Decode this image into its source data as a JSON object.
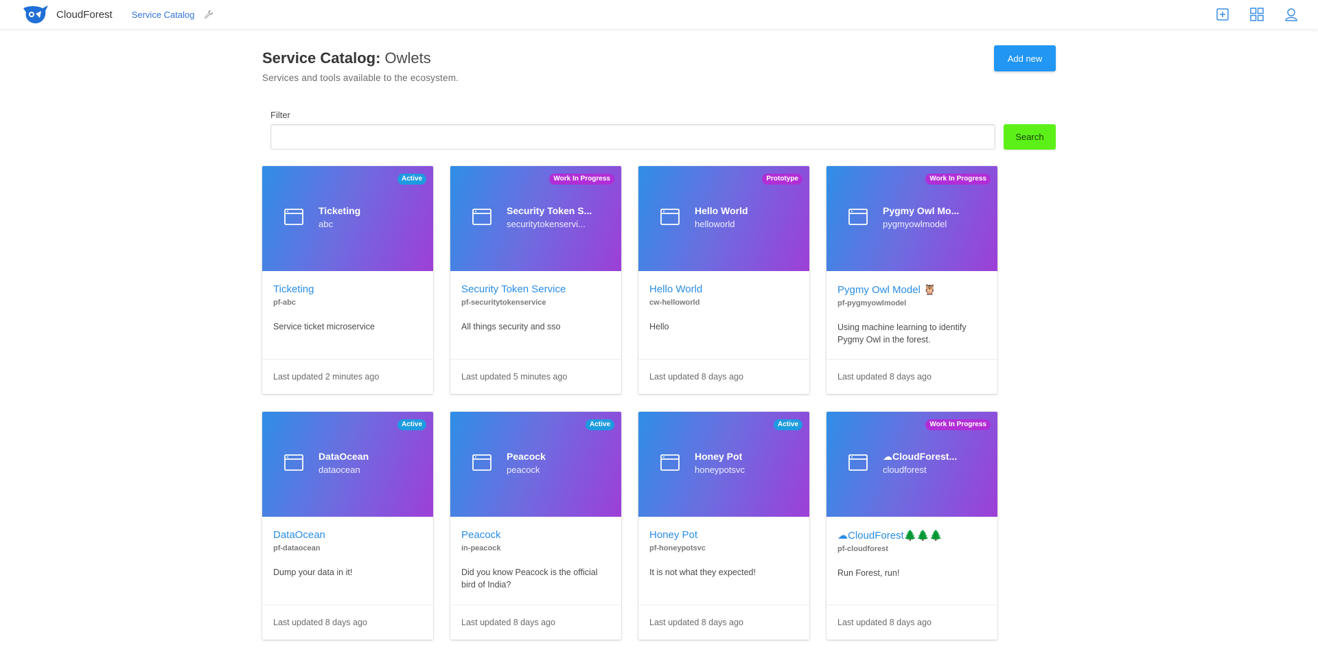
{
  "nav": {
    "brand": "CloudForest",
    "link": "Service Catalog"
  },
  "header": {
    "title_bold": "Service Catalog:",
    "title_sub": "Owlets",
    "description": "Services and tools available to the ecosystem.",
    "add_label": "Add new"
  },
  "filter": {
    "label": "Filter",
    "value": "",
    "search_label": "Search"
  },
  "cards": [
    {
      "badge": "Active",
      "badge_type": "active",
      "hero_title": "Ticketing",
      "hero_sub": "abc",
      "title": "Ticketing",
      "code": "pf-abc",
      "description": "Service ticket microservice",
      "updated": "Last updated 2 minutes ago"
    },
    {
      "badge": "Work In Progress",
      "badge_type": "wip",
      "hero_title": "Security Token S...",
      "hero_sub": "securitytokenservi...",
      "title": "Security Token Service",
      "code": "pf-securitytokenservice",
      "description": "All things security and sso",
      "updated": "Last updated 5 minutes ago"
    },
    {
      "badge": "Prototype",
      "badge_type": "proto",
      "hero_title": "Hello World",
      "hero_sub": "helloworld",
      "title": "Hello World",
      "code": "cw-helloworld",
      "description": "Hello",
      "updated": "Last updated 8 days ago"
    },
    {
      "badge": "Work In Progress",
      "badge_type": "wip",
      "hero_title": "Pygmy Owl Mo...",
      "hero_sub": "pygmyowlmodel",
      "title": "Pygmy Owl Model 🦉",
      "code": "pf-pygmyowlmodel",
      "description": "Using machine learning to identify Pygmy Owl in the forest.",
      "updated": "Last updated 8 days ago"
    },
    {
      "badge": "Active",
      "badge_type": "active",
      "hero_title": "DataOcean",
      "hero_sub": "dataocean",
      "title": "DataOcean",
      "code": "pf-dataocean",
      "description": "Dump your data in it!",
      "updated": "Last updated 8 days ago"
    },
    {
      "badge": "Active",
      "badge_type": "active",
      "hero_title": "Peacock",
      "hero_sub": "peacock",
      "title": "Peacock",
      "code": "in-peacock",
      "description": "Did you know Peacock is the official bird of India?",
      "updated": "Last updated 8 days ago"
    },
    {
      "badge": "Active",
      "badge_type": "active",
      "hero_title": "Honey Pot",
      "hero_sub": "honeypotsvc",
      "title": "Honey Pot",
      "code": "pf-honeypotsvc",
      "description": "It is not what they expected!",
      "updated": "Last updated 8 days ago"
    },
    {
      "badge": "Work In Progress",
      "badge_type": "wip",
      "hero_title": "☁CloudForest...",
      "hero_sub": "cloudforest",
      "title": "☁CloudForest🌲🌲🌲",
      "code": "pf-cloudforest",
      "description": "Run Forest, run!",
      "updated": "Last updated 8 days ago"
    }
  ]
}
